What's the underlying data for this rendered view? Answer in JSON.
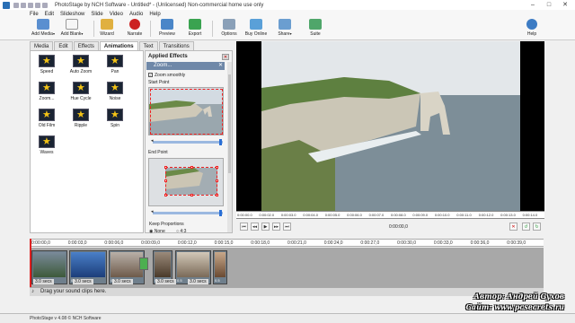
{
  "window": {
    "title": "PhotoStage by NCH Software - Untitled* - (Unlicensed) Non-commercial home use only"
  },
  "menu": [
    "File",
    "Edit",
    "Slideshow",
    "Slide",
    "Video",
    "Audio",
    "Help"
  ],
  "toolbar": [
    {
      "label": "Add Media",
      "icon": "add-media-icon"
    },
    {
      "label": "Add Blank",
      "icon": "add-blank-icon"
    },
    {
      "label": "Wizard",
      "icon": "wizard-icon"
    },
    {
      "label": "Narrate",
      "icon": "narrate-icon"
    },
    {
      "label": "Preview",
      "icon": "preview-icon"
    },
    {
      "label": "Export",
      "icon": "export-icon"
    },
    {
      "label": "Options",
      "icon": "options-icon"
    },
    {
      "label": "Buy Online",
      "icon": "buy-online-icon"
    },
    {
      "label": "Share",
      "icon": "share-icon"
    },
    {
      "label": "Suite",
      "icon": "suite-icon"
    },
    {
      "label": "Help",
      "icon": "help-icon"
    }
  ],
  "tabs": [
    "Media",
    "Edit",
    "Effects",
    "Animations",
    "Text",
    "Transitions"
  ],
  "active_tab": "Animations",
  "effects": [
    "Speed",
    "Auto Zoom",
    "Pan",
    "Zoom...",
    "Hue Cycle",
    "Noise",
    "Old Film",
    "Ripple",
    "Spin",
    "Waves"
  ],
  "applied": {
    "header": "Applied Effects",
    "effect_name": "Zoom...",
    "zoom_smoothly": "Zoom smoothly",
    "start_point": "Start Point",
    "end_point": "End Point",
    "keep_proportions": "Keep Proportions",
    "opt_none": "None",
    "opt_4x3": "4:3"
  },
  "preview": {
    "ruler_labels": [
      "0:00:00.0",
      "0:00:02.0",
      "0:00:03.0",
      "0:00:04.0",
      "0:00:05.0",
      "0:00:06.0",
      "0:00:07.0",
      "0:00:08.0",
      "0:00:09.0",
      "0:00:10.0",
      "0:00:11.0",
      "0:00:12.0",
      "0:00:13.0",
      "0:00:14.0"
    ],
    "time": "0:00:00,0"
  },
  "timeline": {
    "labels": [
      "0:00:00,0",
      "0:00:03,0",
      "0:00:06,0",
      "0:00:09,0",
      "0:00:12,0",
      "0:00:15,0",
      "0:00:18,0",
      "0:00:21,0",
      "0:00:24,0",
      "0:00:27,0",
      "0:00:30,0",
      "0:00:33,0",
      "0:00:36,0",
      "0:00:39,0"
    ],
    "clip_captions": [
      "3.0 secs",
      "3.0 secs",
      "3.0 secs",
      "3.0 secs",
      "3.0 secs"
    ],
    "clip_small": [
      "0.5",
      "0.5",
      "0.5",
      "0.5",
      "0.5",
      "0.5",
      "0.5"
    ],
    "sound_hint": "Drag your sound clips here."
  },
  "status": "PhotoStage v 4.08 © NCH Software",
  "watermark": {
    "author": "Автор: Андрей Сухов",
    "site": "Сайт: www.pcsecrets.ru"
  },
  "colors": {
    "accent": "#2a6fb5",
    "zoom_bar": "#6f88a8",
    "playhead": "#dd2222",
    "star": "#f3c316"
  }
}
